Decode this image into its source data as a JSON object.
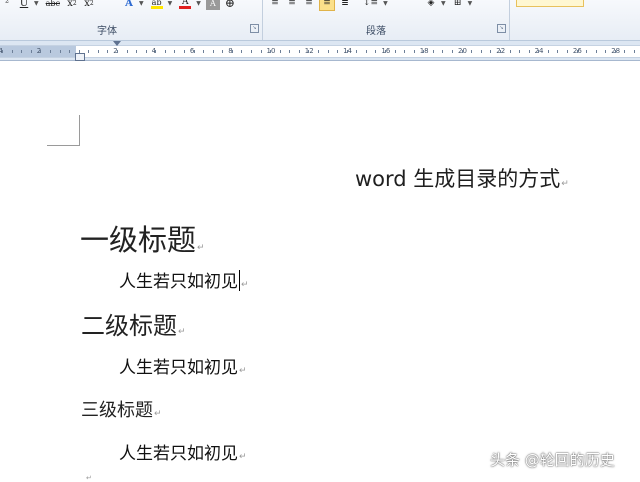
{
  "ribbon": {
    "font_group_label": "字体",
    "paragraph_group_label": "段落",
    "font_buttons": [
      {
        "name": "superscript-button",
        "glyph": "²"
      },
      {
        "name": "underline-button",
        "glyph": "U"
      },
      {
        "name": "strikethrough-button",
        "glyph": "abc"
      },
      {
        "name": "subscript-button",
        "glyph": "x₂"
      },
      {
        "name": "superscript-x-button",
        "glyph": "x²"
      },
      {
        "name": "text-effects-button",
        "glyph": "A"
      },
      {
        "name": "highlight-button",
        "glyph": "ab"
      },
      {
        "name": "font-color-button",
        "glyph": "A"
      },
      {
        "name": "char-shading-button",
        "glyph": "A"
      },
      {
        "name": "enclose-char-button",
        "glyph": "⊕"
      }
    ],
    "colors": {
      "highlight": "#ffe600",
      "font_color": "#e02020",
      "active": "#fbe08a"
    }
  },
  "ruler": {
    "labels": [
      "4",
      "2",
      "2",
      "4",
      "6",
      "8",
      "10",
      "12",
      "14",
      "16",
      "18",
      "20",
      "22",
      "24",
      "26",
      "28",
      "30"
    ]
  },
  "document": {
    "title": "word 生成目录的方式",
    "heading1": "一级标题",
    "body1": "人生若只如初见",
    "heading2": "二级标题",
    "body2": "人生若只如初见",
    "heading3": "三级标题",
    "body3": "人生若只如初见",
    "paragraph_mark": "↵"
  },
  "watermark": "头条 @轮回的历史"
}
